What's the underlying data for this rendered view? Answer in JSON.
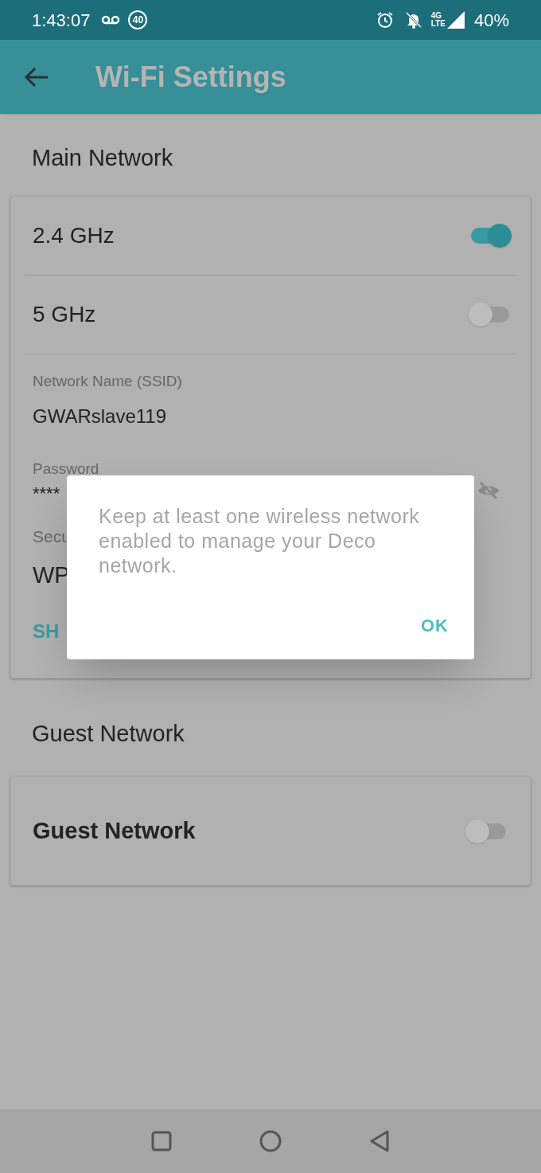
{
  "status_bar": {
    "time": "1:43:07",
    "badge": "40",
    "network_top": "4G",
    "network_bottom": "LTE",
    "battery": "40%"
  },
  "header": {
    "title": "Wi‑Fi Settings"
  },
  "main_network": {
    "title": "Main Network",
    "bands": [
      {
        "label": "2.4 GHz",
        "on": true
      },
      {
        "label": "5 GHz",
        "on": false
      }
    ],
    "ssid_label": "Network Name (SSID)",
    "ssid": "GWARslave119",
    "password_label": "Password",
    "password": "****",
    "security_label": "Secu",
    "security": "WP",
    "share": "SH"
  },
  "guest_network": {
    "title": "Guest Network",
    "toggle": {
      "label": "Guest Network",
      "on": false
    }
  },
  "dialog": {
    "message": "Keep at least one wireless network enabled to manage your Deco network.",
    "button": "OK"
  }
}
